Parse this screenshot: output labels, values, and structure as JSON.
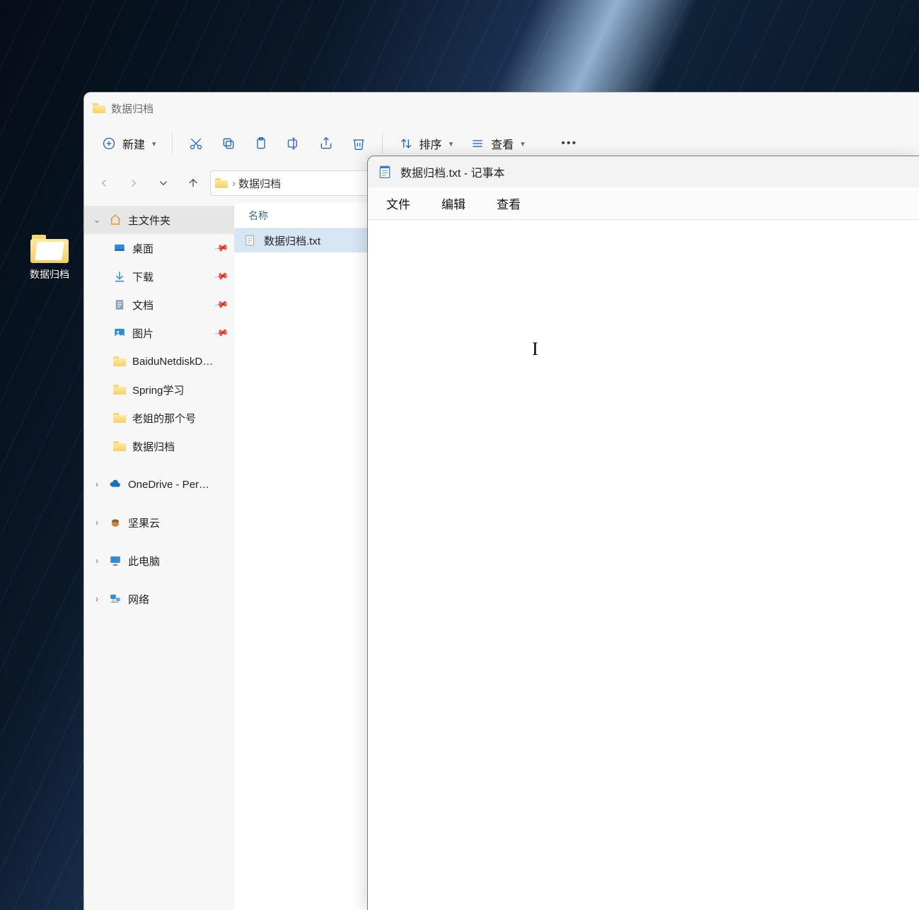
{
  "desktop": {
    "icon_label": "数据归档"
  },
  "explorer": {
    "title": "数据归档",
    "toolbar": {
      "new_label": "新建",
      "sort_label": "排序",
      "view_label": "查看"
    },
    "breadcrumb": {
      "folder": "数据归档"
    },
    "columns": {
      "name": "名称"
    },
    "sidebar": {
      "home": "主文件夹",
      "desktop": "桌面",
      "downloads": "下载",
      "documents": "文档",
      "pictures": "图片",
      "baidu": "BaiduNetdiskDownload",
      "spring": "Spring学习",
      "laojie": "老姐的那个号",
      "archive": "数据归档",
      "onedrive": "OneDrive - Personal",
      "jianguo": "坚果云",
      "thispc": "此电脑",
      "network": "网络"
    },
    "files": [
      {
        "name": "数据归档.txt"
      }
    ]
  },
  "notepad": {
    "title": "数据归档.txt - 记事本",
    "menu": {
      "file": "文件",
      "edit": "编辑",
      "view": "查看"
    }
  }
}
